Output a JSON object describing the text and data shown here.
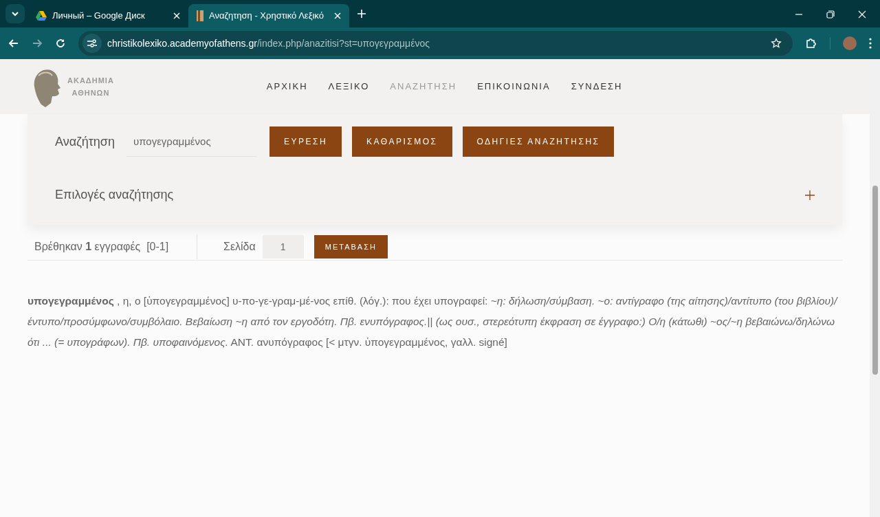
{
  "browser": {
    "tabs": [
      {
        "title": "Личный – Google Диск",
        "selected": false
      },
      {
        "title": "Αναζητηση - Χρηστικό Λεξικό",
        "selected": true
      }
    ],
    "url_host": "christikolexiko.academyofathens.gr",
    "url_path": "/index.php/anazitisi?st=υπογεγραμμένος"
  },
  "site": {
    "logo_line_1": "ΑΚΑΔΗΜΙΑ",
    "logo_line_2": "ΑΘΗΝΩΝ",
    "nav": [
      {
        "label": "ΑΡΧΙΚΗ",
        "selected": false
      },
      {
        "label": "ΛΕΞΙΚΟ",
        "selected": false
      },
      {
        "label": "ΑΝΑΖΗΤΗΣΗ",
        "selected": true
      },
      {
        "label": "ΕΠΙΚΟΙΝΩΝΙΑ",
        "selected": false
      },
      {
        "label": "ΣΥΝΔΕΣΗ",
        "selected": false
      }
    ]
  },
  "search": {
    "label": "Αναζήτηση",
    "value": "υπογεγραμμένος",
    "buttons": [
      "ΕΥΡΕΣΗ",
      "ΚΑΘΑΡΙΣΜΟΣ",
      "ΟΔΗΓΙΕΣ ΑΝΑΖΗΤΗΣΗΣ"
    ],
    "options": {
      "label": "Επιλογές αναζήτησης",
      "expanded": false
    }
  },
  "results": {
    "found": "Βρέθηκαν **1** εγγραφές  [0-1]",
    "page_label": "Σελίδα",
    "page_value": "1",
    "go_button": "ΜΕΤΑΒΑΣΗ"
  },
  "entry": "**υπογεγραμμένος** , η, ο [ὑπογεγραμμένος] υ-πο-γε-γραμ-μέ-νος επίθ. (λόγ.): που έχει υπογραφεί: *~η: δήλωση/σύμβαση. ~ο: αντίγραφο (της αίτησης)/αντίτυπο (του βιβλίου)/έντυπο/προσύμφωνο/συμβόλαιο. Βεβαίωση ~η από τον εργοδότη. Πβ. ενυπόγραφος.|| (ως ουσ., στερεότυπη έκφραση σε έγγραφο:) Ο/η (κάτωθι) ~ος/~η βεβαιώνω/δηλώνω ότι ... (= υπογράφων). Πβ. υποφαινόμενος.* ΑΝΤ. ανυπόγραφος [< μτγν. ὑπογεγραμμένος, γαλλ. signé]"
}
